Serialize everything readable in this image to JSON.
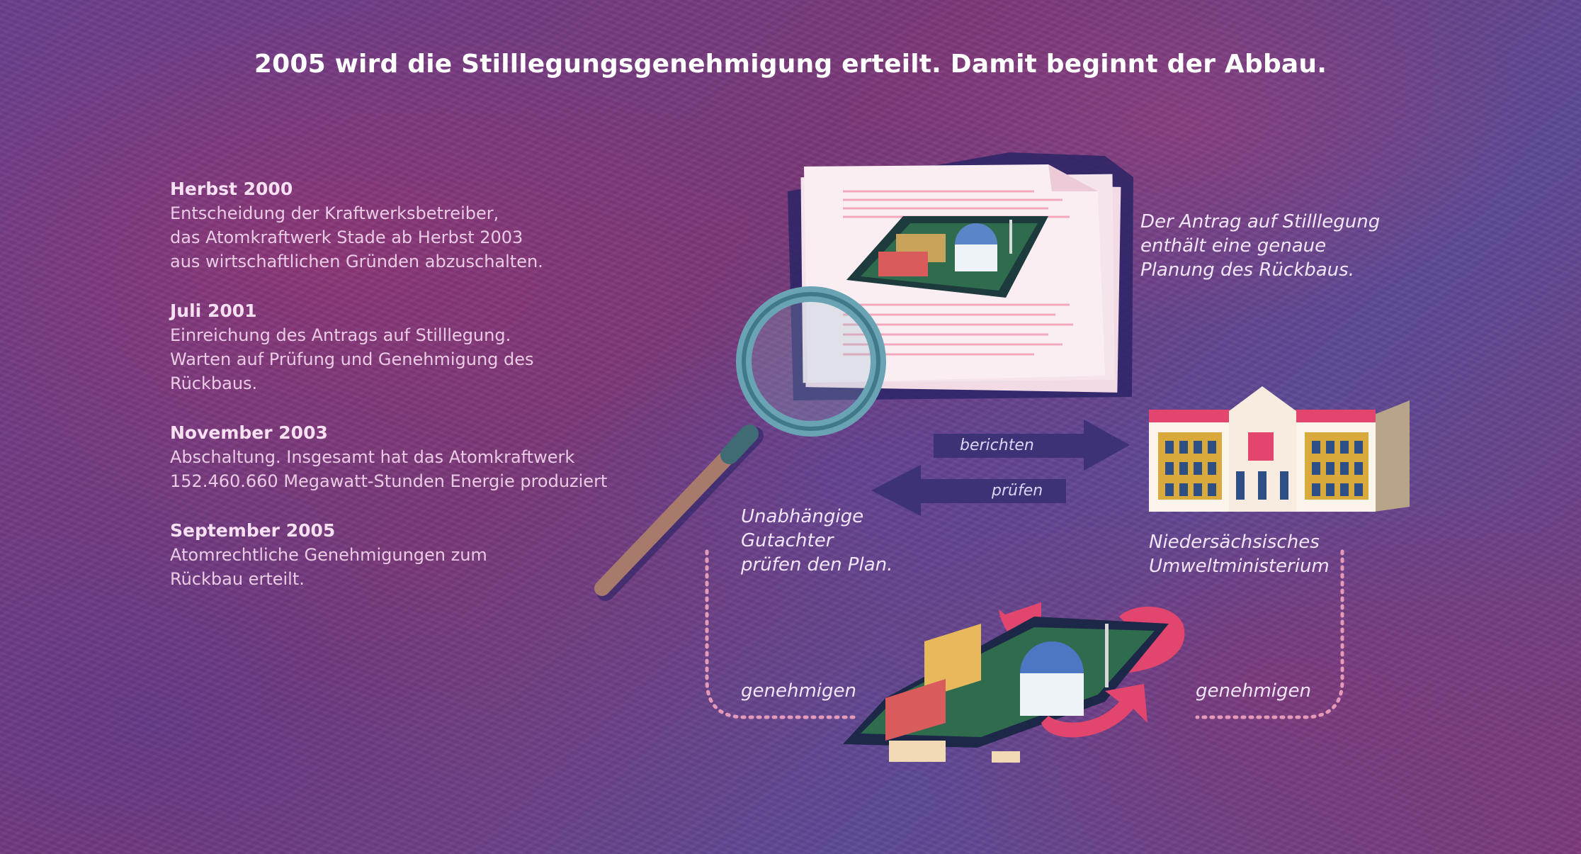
{
  "headline": "2005 wird die Stilllegungsgenehmigung erteilt. Damit beginnt der Abbau.",
  "timeline": [
    {
      "date": "Herbst 2000",
      "text": "Entscheidung der Kraftwerksbetreiber,\ndas Atomkraftwerk Stade ab Herbst 2003\naus wirtschaftlichen Gründen abzuschalten."
    },
    {
      "date": "Juli 2001",
      "text": "Einreichung des Antrags auf Stilllegung.\nWarten auf Prüfung und Genehmigung des\nRückbaus."
    },
    {
      "date": "November 2003",
      "text": "Abschaltung. Insgesamt hat das Atomkraftwerk\n152.460.660 Megawatt-Stunden Energie produziert"
    },
    {
      "date": "September 2005",
      "text": "Atomrechtliche Genehmigungen zum\nRückbau erteilt."
    }
  ],
  "captions": {
    "antrag": "Der Antrag auf Stilllegung\nenthält eine genaue\nPlanung des Rückbaus.",
    "gutachter": "Unabhängige\nGutachter\nprüfen den Plan.",
    "ministerium": "Niedersächsisches\nUmweltministerium",
    "genehmigen_left": "genehmigen",
    "genehmigen_right": "genehmigen"
  },
  "arrows": {
    "berichten": "berichten",
    "pruefen": "prüfen"
  },
  "colors": {
    "arrow": "#3c3275",
    "accent_pink": "#e2456e",
    "dotted": "#e59ab8"
  }
}
